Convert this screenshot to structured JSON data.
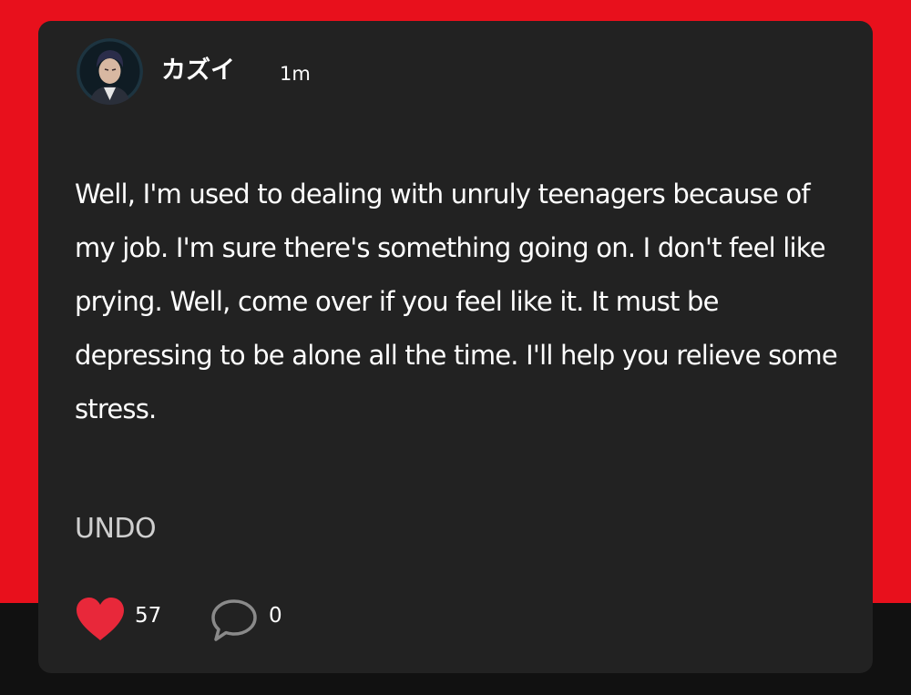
{
  "colors": {
    "background_top": "#e8101c",
    "background_bottom": "#111111",
    "card_background": "#222222",
    "text_primary": "#ffffff",
    "text_muted": "#cfcfcf",
    "like_heart": "#e8283a",
    "comment_outline": "#8a8a8a"
  },
  "post": {
    "author": {
      "name": "カズイ",
      "avatar_icon": "user-avatar"
    },
    "timestamp": "1m",
    "message": "Well, I'm used to dealing with unruly teenagers because of my job. I'm sure there's something going on. I don't feel like prying. Well, come over if you feel like it. It must be depressing to be alone all the time. I'll help you relieve some stress.",
    "undo_label": "UNDO"
  },
  "actions": {
    "like": {
      "icon": "heart-icon",
      "count": "57"
    },
    "comment": {
      "icon": "speech-bubble-icon",
      "count": "0"
    }
  }
}
